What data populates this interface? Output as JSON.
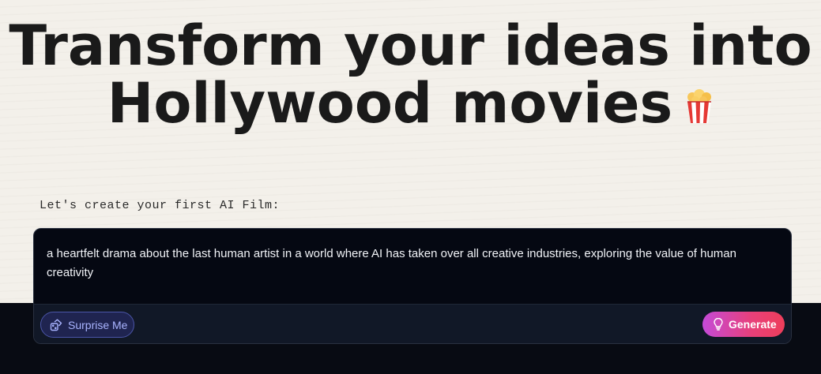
{
  "hero": {
    "title_line1": "Transform your ideas into",
    "title_line2": "Hollywood movies",
    "emoji_icon": "popcorn-icon"
  },
  "prompt": {
    "label": "Let's create your first AI Film:",
    "text": "a heartfelt drama about the last human artist in a world where AI has taken over all creative industries, exploring the value of human creativity"
  },
  "actions": {
    "surprise_label": "Surprise Me",
    "surprise_icon": "dice-icon",
    "generate_label": "Generate",
    "generate_icon": "lightbulb-icon"
  },
  "colors": {
    "page_bg": "#f3f0ea",
    "dark_band": "#080b13",
    "composer_bg": "#050812",
    "accent_gradient_start": "#c44ad8",
    "accent_gradient_end": "#ee3e5a",
    "surprise_bg": "#1f2450"
  }
}
